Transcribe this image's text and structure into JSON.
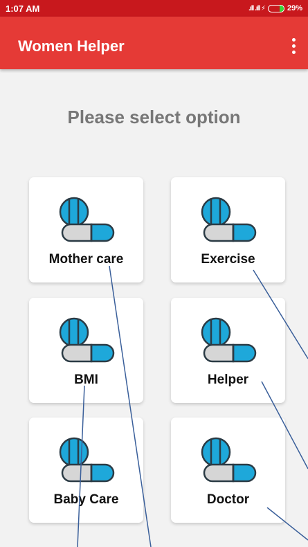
{
  "status_bar": {
    "time": "1:07 AM",
    "signal": ".ıll .ıll ⚡",
    "battery_percent": "29%",
    "battery_level": 0.29,
    "battery_color": "#38d838"
  },
  "app_bar": {
    "title": "Women Helper",
    "menu_icon": "more-vert-icon",
    "color": "#e53a36"
  },
  "prompt": "Please select option",
  "options": [
    {
      "label": "Mother care",
      "icon": "pill-capsule-icon"
    },
    {
      "label": "Exercise",
      "icon": "pill-capsule-icon"
    },
    {
      "label": "BMI",
      "icon": "pill-capsule-icon"
    },
    {
      "label": "Helper",
      "icon": "pill-capsule-icon"
    },
    {
      "label": "Baby Care",
      "icon": "pill-capsule-icon"
    },
    {
      "label": "Doctor",
      "icon": "pill-capsule-icon"
    }
  ]
}
